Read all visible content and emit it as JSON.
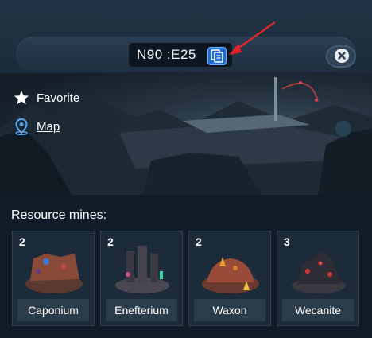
{
  "header": {
    "coordinates": "N90 :E25",
    "copy_icon": "copy-icon",
    "close_icon": "close-icon"
  },
  "side_menu": {
    "favorite_label": "Favorite",
    "favorite_icon": "star-icon",
    "map_label": "Map",
    "map_icon": "location-pin-icon"
  },
  "resource_mines": {
    "title": "Resource mines:",
    "items": [
      {
        "level": "2",
        "name": "Caponium"
      },
      {
        "level": "2",
        "name": "Enefterium"
      },
      {
        "level": "2",
        "name": "Waxon"
      },
      {
        "level": "3",
        "name": "Wecanite"
      }
    ]
  },
  "colors": {
    "accent_blue": "#1a6fd6",
    "annotation_arrow": "#e0262b"
  }
}
